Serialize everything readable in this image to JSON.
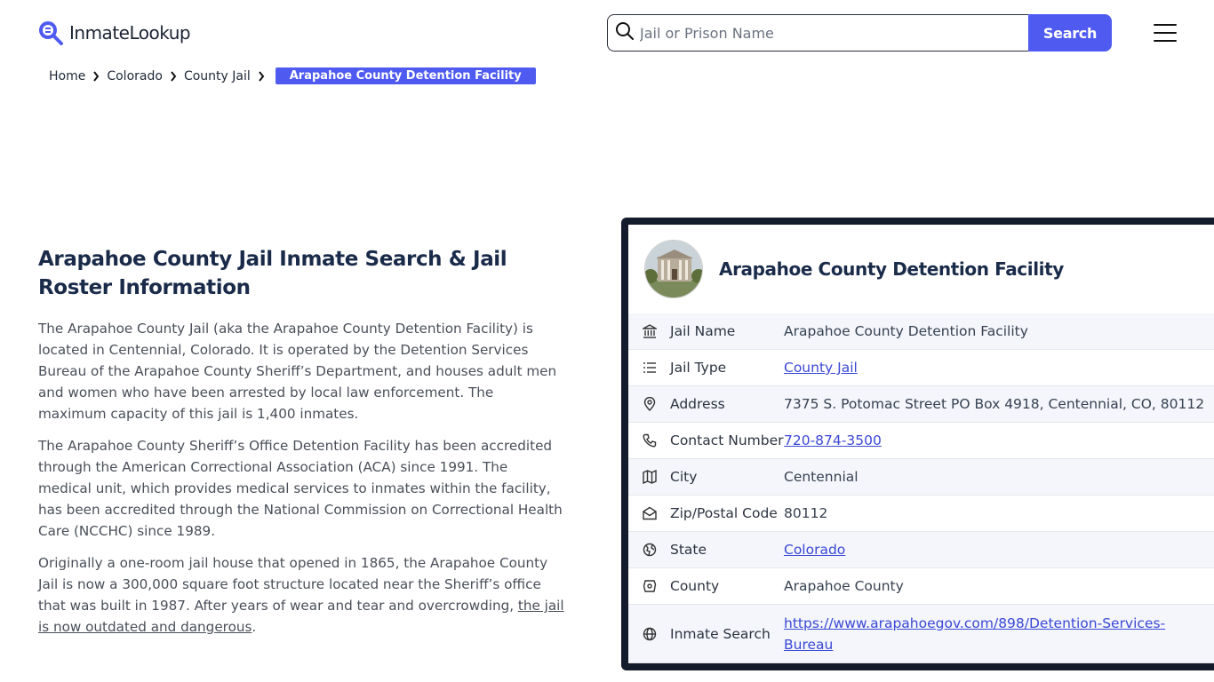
{
  "header": {
    "logo_text": "InmateLookup",
    "search_placeholder": "Jail or Prison Name",
    "search_button": "Search"
  },
  "breadcrumb": {
    "items": [
      "Home",
      "Colorado",
      "County Jail"
    ],
    "active": "Arapahoe County Detention Facility"
  },
  "article": {
    "title": "Arapahoe County Jail Inmate Search & Jail Roster Information",
    "paragraphs": [
      "The Arapahoe County Jail (aka the Arapahoe County Detention Facility) is located in Centennial, Colorado. It is operated by the Detention Services Bureau of the Arapahoe County Sheriff’s Department, and houses adult men and women who have been arrested by local law enforcement. The maximum capacity of this jail is 1,400 inmates.",
      "The Arapahoe County Sheriff’s Office Detention Facility has been accredited through the American Correctional Association (ACA) since 1991. The medical unit, which provides medical services to inmates within the facility, has been accredited through the National Commission on Correctional Health Care (NCCHC) since 1989."
    ],
    "paragraph3_text": "Originally a one-room jail house that opened in 1865, the Arapahoe County Jail is now a 300,000 square foot structure located near the Sheriff’s office that was built in 1987. After years of wear and tear and overcrowding, ",
    "paragraph3_link": "the jail is now outdated and dangerous",
    "paragraph3_end": "."
  },
  "card": {
    "title": "Arapahoe County Detention Facility",
    "rows": [
      {
        "icon": "building-icon",
        "label": "Jail Name",
        "value": "Arapahoe County Detention Facility",
        "link": false
      },
      {
        "icon": "list-icon",
        "label": "Jail Type",
        "value": "County Jail",
        "link": true
      },
      {
        "icon": "map-pin-icon",
        "label": "Address",
        "value": "7375 S. Potomac Street PO Box 4918, Centennial, CO, 80112",
        "link": false
      },
      {
        "icon": "phone-icon",
        "label": "Contact Number",
        "value": "720-874-3500",
        "link": true
      },
      {
        "icon": "map-icon",
        "label": "City",
        "value": "Centennial",
        "link": false
      },
      {
        "icon": "mail-icon",
        "label": "Zip/Postal Code",
        "value": "80112",
        "link": false
      },
      {
        "icon": "globe-state-icon",
        "label": "State",
        "value": "Colorado",
        "link": true
      },
      {
        "icon": "county-icon",
        "label": "County",
        "value": "Arapahoe County",
        "link": false
      },
      {
        "icon": "globe-icon",
        "label": "Inmate Search",
        "value": "https://www.arapahoegov.com/898/Detention-Services-Bureau",
        "link": true
      }
    ]
  },
  "colors": {
    "accent": "#4f5bf0",
    "card_border": "#141b2d",
    "title": "#1a2b4a",
    "link": "#3b48d6"
  }
}
